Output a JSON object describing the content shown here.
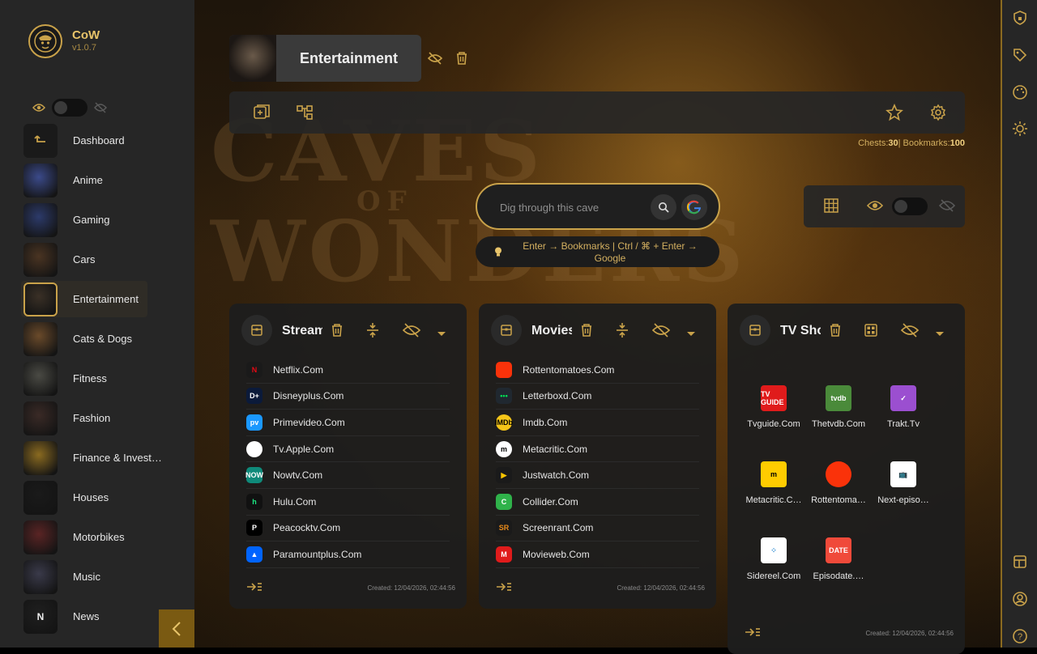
{
  "app": {
    "name": "CoW",
    "version": "v1.0.7"
  },
  "sidebar": {
    "items": [
      {
        "label": "Dashboard",
        "icon": "back-arrow-icon",
        "color": "#2a2a2a"
      },
      {
        "label": "Anime",
        "color": "#3b4a8a"
      },
      {
        "label": "Gaming",
        "color": "#2c3a6a"
      },
      {
        "label": "Cars",
        "color": "#4a3422"
      },
      {
        "label": "Entertainment",
        "color": "#3a3026",
        "active": true
      },
      {
        "label": "Cats & Dogs",
        "color": "#6a4a2a"
      },
      {
        "label": "Fitness",
        "color": "#4a4a44"
      },
      {
        "label": "Fashion",
        "color": "#3a2a26"
      },
      {
        "label": "Finance & Invest…",
        "color": "#8a6a20"
      },
      {
        "label": "Houses",
        "color": "#1a1a1a"
      },
      {
        "label": "Motorbikes",
        "color": "#5a2424"
      },
      {
        "label": "Music",
        "color": "#3a3a4a"
      },
      {
        "label": "News",
        "thumb_text": "N",
        "color": "#1f1f1f"
      }
    ]
  },
  "header": {
    "chest_title": "Entertainment"
  },
  "stats": {
    "chests_label": "Chests:",
    "chests": "30",
    "sep": "| Bookmarks:",
    "bookmarks": "100"
  },
  "search": {
    "placeholder": "Dig through this cave",
    "hint": "Enter → Bookmarks | Ctrl / ⌘ + Enter → Google"
  },
  "background": {
    "line1": "CAVES",
    "line2": "OF",
    "line3": "WONDERS"
  },
  "cards": [
    {
      "title": "Streaming",
      "layout": "list",
      "created": "Created: 12/04/2026, 02:44:56",
      "items": [
        {
          "label": "Netflix.Com",
          "icon": "netflix-icon",
          "color": "#1a1a1a",
          "glyph": "N",
          "glyph_color": "#e50914"
        },
        {
          "label": "Disneyplus.Com",
          "icon": "disneyplus-icon",
          "color": "#0b1a3a",
          "glyph": "D+",
          "glyph_color": "#ffffff"
        },
        {
          "label": "Primevideo.Com",
          "icon": "primevideo-icon",
          "color": "#1a98ff",
          "glyph": "pv",
          "glyph_color": "#ffffff"
        },
        {
          "label": "Tv.Apple.Com",
          "icon": "apple-icon",
          "color": "#ffffff",
          "glyph": "",
          "glyph_color": "#000000"
        },
        {
          "label": "Nowtv.Com",
          "icon": "nowtv-icon",
          "color": "#0f8a7a",
          "glyph": "NOW",
          "glyph_color": "#ffffff"
        },
        {
          "label": "Hulu.Com",
          "icon": "hulu-icon",
          "color": "#111111",
          "glyph": "h",
          "glyph_color": "#1ce783"
        },
        {
          "label": "Peacocktv.Com",
          "icon": "peacock-icon",
          "color": "#000000",
          "glyph": "P",
          "glyph_color": "#ffffff"
        },
        {
          "label": "Paramountplus.Com",
          "icon": "paramount-icon",
          "color": "#0064ff",
          "glyph": "▲",
          "glyph_color": "#ffffff"
        }
      ]
    },
    {
      "title": "Movies",
      "layout": "list",
      "created": "Created: 12/04/2026, 02:44:56",
      "items": [
        {
          "label": "Rottentomatoes.Com",
          "icon": "tomato-icon",
          "color": "#fa320a",
          "glyph": "",
          "glyph_color": "#ffffff"
        },
        {
          "label": "Letterboxd.Com",
          "icon": "letterboxd-icon",
          "color": "#202830",
          "glyph": "•••",
          "glyph_color": "#00e054"
        },
        {
          "label": "Imdb.Com",
          "icon": "imdb-icon",
          "color": "#f5c518",
          "glyph": "IMDb",
          "glyph_color": "#000000"
        },
        {
          "label": "Metacritic.Com",
          "icon": "metacritic-icon",
          "color": "#ffffff",
          "glyph": "m",
          "glyph_color": "#000000"
        },
        {
          "label": "Justwatch.Com",
          "icon": "justwatch-icon",
          "color": "#1a1a1a",
          "glyph": "▶",
          "glyph_color": "#fbc500"
        },
        {
          "label": "Collider.Com",
          "icon": "collider-icon",
          "color": "#2fb24a",
          "glyph": "C",
          "glyph_color": "#ffffff"
        },
        {
          "label": "Screenrant.Com",
          "icon": "screenrant-icon",
          "color": "#1a1a1a",
          "glyph": "SR",
          "glyph_color": "#e88a1a"
        },
        {
          "label": "Movieweb.Com",
          "icon": "movieweb-icon",
          "color": "#e01b1b",
          "glyph": "M",
          "glyph_color": "#ffffff"
        }
      ]
    },
    {
      "title": "TV Shows",
      "layout": "grid",
      "created": "Created: 12/04/2026, 02:44:56",
      "items": [
        {
          "label": "Tvguide.Com",
          "icon": "tvguide-icon",
          "color": "#e01b1b",
          "glyph": "TV GUIDE",
          "glyph_color": "#ffffff"
        },
        {
          "label": "Thetvdb.Com",
          "icon": "thetvdb-icon",
          "color": "#4a8a3a",
          "glyph": "tvdb",
          "glyph_color": "#ffffff"
        },
        {
          "label": "Trakt.Tv",
          "icon": "trakt-icon",
          "color": "#9b4fd0",
          "glyph": "✓",
          "glyph_color": "#ffffff"
        },
        {
          "label": "Metacritic.C…",
          "icon": "metacritic-icon",
          "color": "#ffcc00",
          "glyph": "m",
          "glyph_color": "#000000"
        },
        {
          "label": "Rottentoma…",
          "icon": "tomato-icon",
          "color": "#fa320a",
          "glyph": "",
          "glyph_color": "#ffffff"
        },
        {
          "label": "Next-episo…",
          "icon": "next-episode-icon",
          "color": "#ffffff",
          "glyph": "📺",
          "glyph_color": "#2a6adf"
        },
        {
          "label": "Sidereel.Com",
          "icon": "sidereel-icon",
          "color": "#ffffff",
          "glyph": "⁘",
          "glyph_color": "#2a8ad0"
        },
        {
          "label": "Episodate.…",
          "icon": "episodate-icon",
          "color": "#f04a3a",
          "glyph": "DATE",
          "glyph_color": "#ffffff"
        }
      ]
    }
  ],
  "colors": {
    "accent": "#c9a24a",
    "panel": "#262626"
  }
}
